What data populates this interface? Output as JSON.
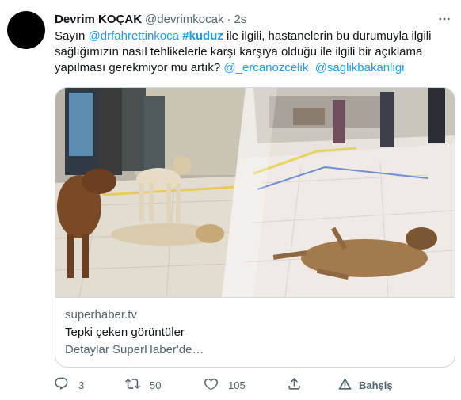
{
  "tweet": {
    "display_name": "Devrim KOÇAK",
    "handle": "@devrimkocak",
    "separator": "·",
    "time": "2s",
    "more_icon": "more-horizontal-icon",
    "text_parts": {
      "p1": "Sayın ",
      "mention1": "@drfahrettinkoca",
      "p2": " ",
      "hashtag": "#kuduz",
      "p3": " ile ilgili, hastanelerin bu durumuyla ilgili sağlığımızın nasıl tehlikelerle karşı karşıya olduğu ile ilgili bir açıklama yapılması gerekmiyor mu artık? ",
      "mention2": "@_ercanozcelik",
      "p4": "  ",
      "mention3": "@saglikbakanligi"
    }
  },
  "card": {
    "domain": "superhaber.tv",
    "title": "Tepki çeken görüntüler",
    "description": "Detaylar SuperHaber'de…"
  },
  "actions": {
    "reply_count": "3",
    "retweet_count": "50",
    "like_count": "105",
    "tip_label": "Bahşiş"
  },
  "colors": {
    "link": "#1d9bf0",
    "secondary_text": "#536471",
    "border": "#cfd9de"
  }
}
